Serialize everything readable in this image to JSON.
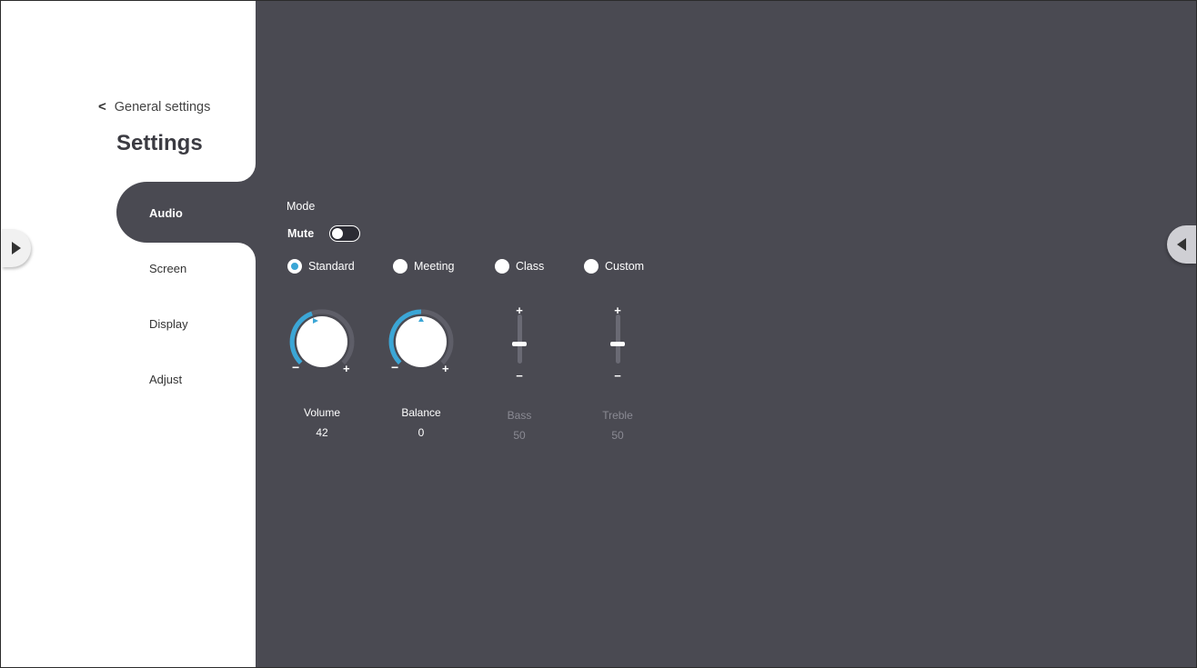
{
  "sidebar": {
    "back_label": "General settings",
    "title": "Settings",
    "items": [
      {
        "label": "Audio",
        "active": true
      },
      {
        "label": "Screen",
        "active": false
      },
      {
        "label": "Display",
        "active": false
      },
      {
        "label": "Adjust",
        "active": false
      }
    ]
  },
  "audio": {
    "mode_label": "Mode",
    "mute_label": "Mute",
    "mute_on": false,
    "modes": [
      {
        "label": "Standard",
        "selected": true
      },
      {
        "label": "Meeting",
        "selected": false
      },
      {
        "label": "Class",
        "selected": false
      },
      {
        "label": "Custom",
        "selected": false
      }
    ],
    "controls": {
      "volume": {
        "label": "Volume",
        "value": "42"
      },
      "balance": {
        "label": "Balance",
        "value": "0"
      },
      "bass": {
        "label": "Bass",
        "value": "50"
      },
      "treble": {
        "label": "Treble",
        "value": "50"
      }
    },
    "minus_symbol": "−",
    "plus_symbol": "+"
  },
  "colors": {
    "accent": "#3ba6d6",
    "panel": "#4a4a52",
    "sidebar": "#ffffff"
  }
}
